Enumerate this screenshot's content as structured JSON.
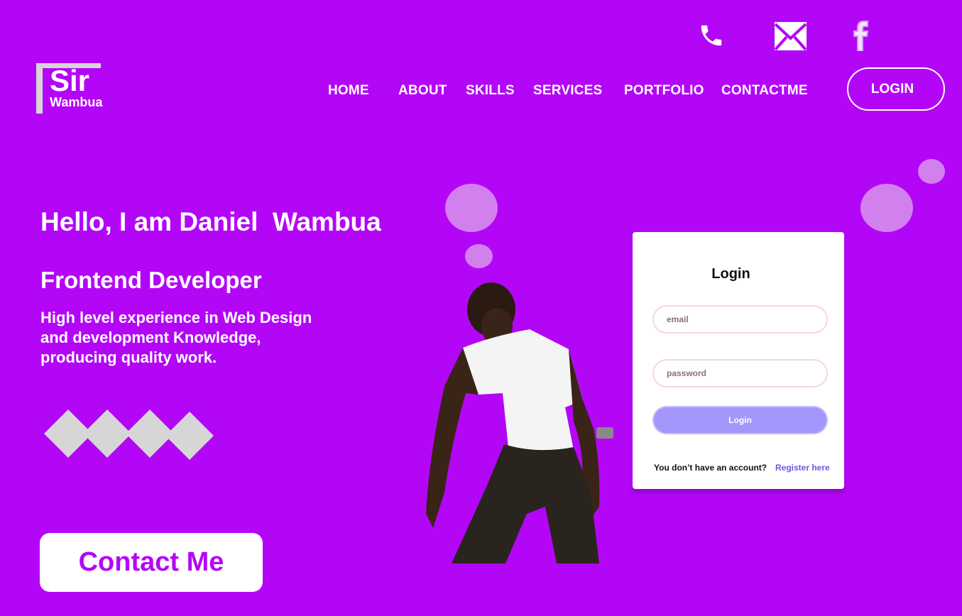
{
  "colors": {
    "background": "#b406f7",
    "accent": "#b406f7",
    "card_button": "#a397fb",
    "link": "#6b56e0",
    "shape_gray": "#d6d6d6"
  },
  "top_icons": [
    "phone-icon",
    "mail-icon",
    "facebook-icon"
  ],
  "logo": {
    "line1": "Sir",
    "line2": "Wambua"
  },
  "nav": {
    "items": [
      "HOME",
      "ABOUT",
      "SKILLS",
      "SERVICES",
      "PORTFOLIO",
      "CONTACTME"
    ],
    "login": "LOGIN"
  },
  "hero": {
    "title": "Hello, I am Daniel  Wambua",
    "subtitle": "Frontend Developer",
    "description": "High level experience in Web Design and development Knowledge, producing quality work.",
    "contact_button": "Contact Me"
  },
  "login_card": {
    "title": "Login",
    "email_placeholder": "email",
    "password_placeholder": "password",
    "button": "Login",
    "footer_text": "You don’t have an account?",
    "register_link": "Register here"
  }
}
